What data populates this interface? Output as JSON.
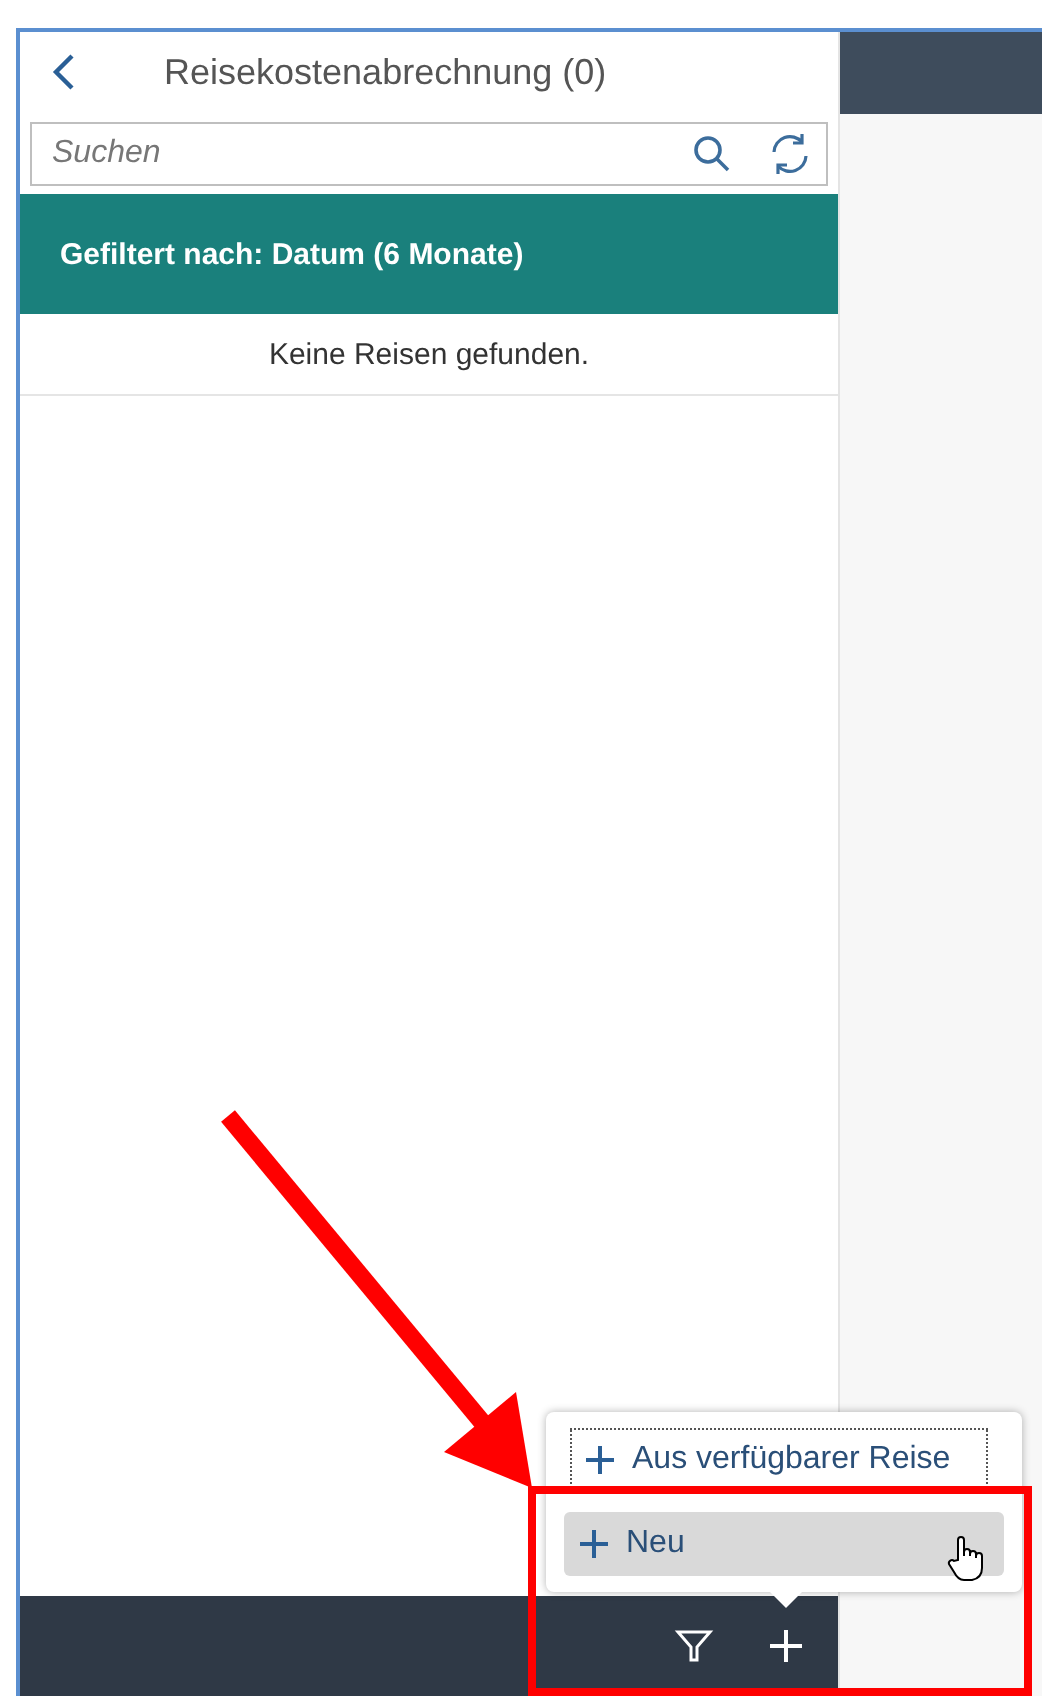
{
  "header": {
    "title": "Reisekostenabrechnung (0)"
  },
  "search": {
    "placeholder": "Suchen"
  },
  "filter_bar": {
    "text": "Gefiltert nach: Datum (6 Monate)"
  },
  "list": {
    "empty_text": "Keine Reisen gefunden."
  },
  "menu": {
    "items": [
      {
        "label": "Aus verfügbarer Reise",
        "selected": false,
        "focused": true
      },
      {
        "label": "Neu",
        "selected": true,
        "focused": false
      }
    ]
  }
}
